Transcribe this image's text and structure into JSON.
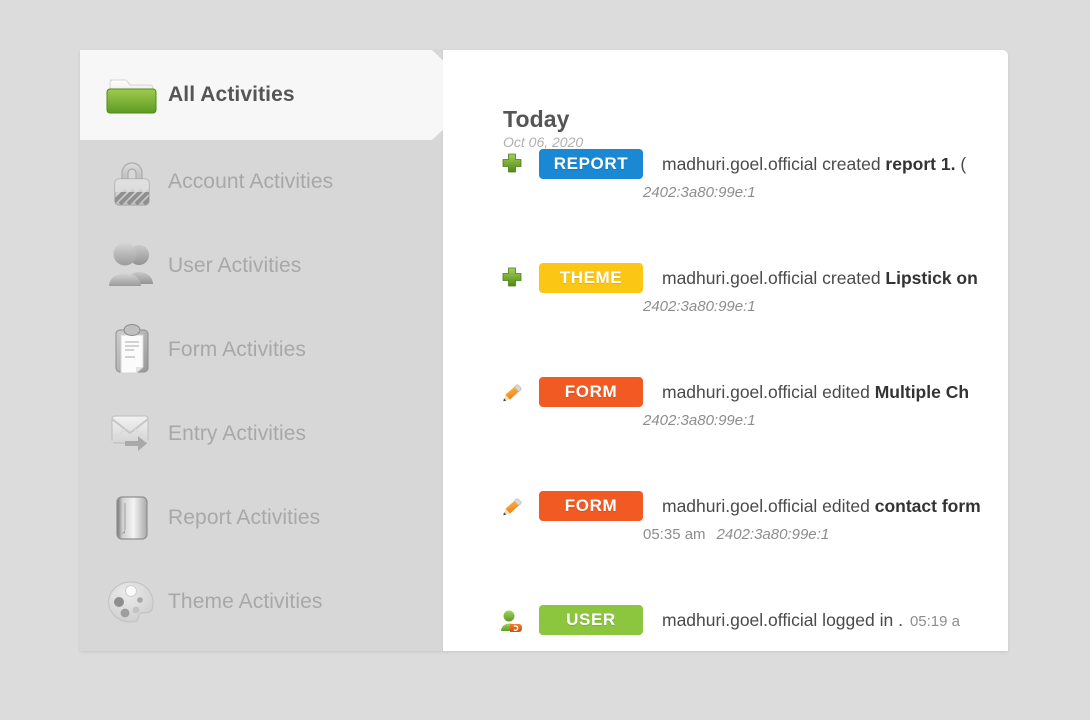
{
  "app": {
    "background_color": "#dcdcdc",
    "panel_color": "#ffffff",
    "sidebar_color": "#d7d7d7"
  },
  "sidebar": {
    "items": [
      {
        "label": "All Activities",
        "icon": "folder-icon",
        "active": true
      },
      {
        "label": "Account Activities",
        "icon": "lock-icon",
        "active": false
      },
      {
        "label": "User Activities",
        "icon": "users-icon",
        "active": false
      },
      {
        "label": "Form Activities",
        "icon": "clipboard-icon",
        "active": false
      },
      {
        "label": "Entry Activities",
        "icon": "envelope-icon",
        "active": false
      },
      {
        "label": "Report Activities",
        "icon": "report-icon",
        "active": false
      },
      {
        "label": "Theme Activities",
        "icon": "palette-icon",
        "active": false
      }
    ]
  },
  "content": {
    "day_title": "Today",
    "day_date": "Oct 06, 2020",
    "activities": [
      {
        "icon": "plus-icon",
        "badge": {
          "text": "REPORT",
          "color": "#1b88d3"
        },
        "action_prefix": "madhuri.goel.official created ",
        "target": "report 1.",
        "trailing": " (",
        "time": "",
        "ip": "2402:3a80:99e:1"
      },
      {
        "icon": "plus-icon",
        "badge": {
          "text": "THEME",
          "color": "#fcc714"
        },
        "action_prefix": "madhuri.goel.official created ",
        "target": "Lipstick on",
        "trailing": "",
        "time": "",
        "ip": "2402:3a80:99e:1"
      },
      {
        "icon": "pencil-icon",
        "badge": {
          "text": "FORM",
          "color": "#f15a22"
        },
        "action_prefix": "madhuri.goel.official edited ",
        "target": "Multiple Ch",
        "trailing": "",
        "time": "",
        "ip": "2402:3a80:99e:1"
      },
      {
        "icon": "pencil-icon",
        "badge": {
          "text": "FORM",
          "color": "#f15a22"
        },
        "action_prefix": "madhuri.goel.official edited ",
        "target": "contact form",
        "trailing": "",
        "time": "05:35 am",
        "ip": "2402:3a80:99e:1"
      },
      {
        "icon": "user-login-icon",
        "badge": {
          "text": "USER",
          "color": "#8cc63e"
        },
        "action_prefix": "madhuri.goel.official logged in .",
        "target": "",
        "trailing": "",
        "inline_time": "05:19 a",
        "ip": ""
      }
    ]
  }
}
